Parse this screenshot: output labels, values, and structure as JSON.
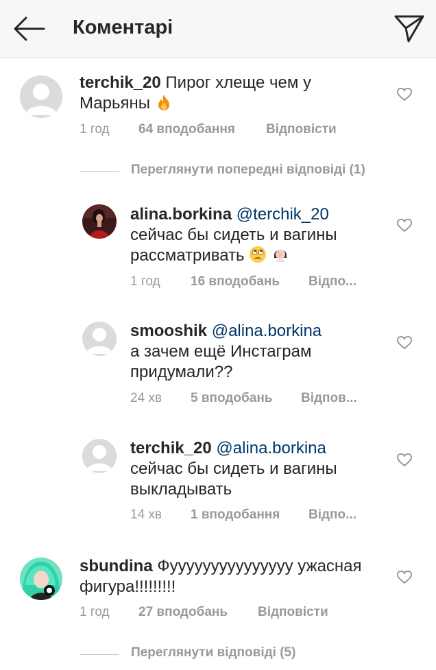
{
  "header": {
    "title": "Коментарі"
  },
  "comments": [
    {
      "username": "terchik_20",
      "text_line1": "Пирог хлеще чем у",
      "text_line2": "Марьяны",
      "time": "1 год",
      "likes": "64 вподобання",
      "reply_label": "Відповісти",
      "avatar": "default-avatar"
    },
    {
      "username": "sbundina",
      "text_line1": "Фууууууууууууууу ужасная",
      "text_line2": "фигура!!!!!!!!!",
      "time": "1 год",
      "likes": "27 вподобань",
      "reply_label": "Відповісти",
      "avatar": "green-hair-photo"
    }
  ],
  "view_replies": [
    {
      "label": "Переглянути попередні відповіді (1)"
    },
    {
      "label": "Переглянути відповіді (5)"
    }
  ],
  "replies": [
    {
      "username": "alina.borkina",
      "mention": "@terchik_20",
      "text_line1": "сейчас бы сидеть и вагины",
      "text_line2": "рассматривать",
      "time": "1 год",
      "likes": "16 вподобань",
      "reply_label": "Відпо...",
      "avatar": "red-dress-photo"
    },
    {
      "username": "smooshik",
      "mention": "@alina.borkina",
      "text_line1": "а зачем ещё Инстаграм",
      "text_line2": "придумали??",
      "time": "24 хв",
      "likes": "5 вподобань",
      "reply_label": "Відпов...",
      "avatar": "default-avatar"
    },
    {
      "username": "terchik_20",
      "mention": "@alina.borkina",
      "text_line1": "сейчас бы сидеть и вагины",
      "text_line2": "выкладывать",
      "time": "14 хв",
      "likes": "1 вподобання",
      "reply_label": "Відпо...",
      "avatar": "default-avatar"
    }
  ],
  "icons": {
    "back": "back-arrow-icon",
    "send": "paper-plane-icon",
    "like": "heart-outline-icon",
    "fire": "fire-emoji",
    "eye_roll": "eye-roll-emoji",
    "facepalm": "facepalm-emoji"
  },
  "colors": {
    "header_bg": "#f7f7f7",
    "text": "#262626",
    "secondary": "#999999",
    "mention": "#003569",
    "divider": "#c7c7c7"
  }
}
